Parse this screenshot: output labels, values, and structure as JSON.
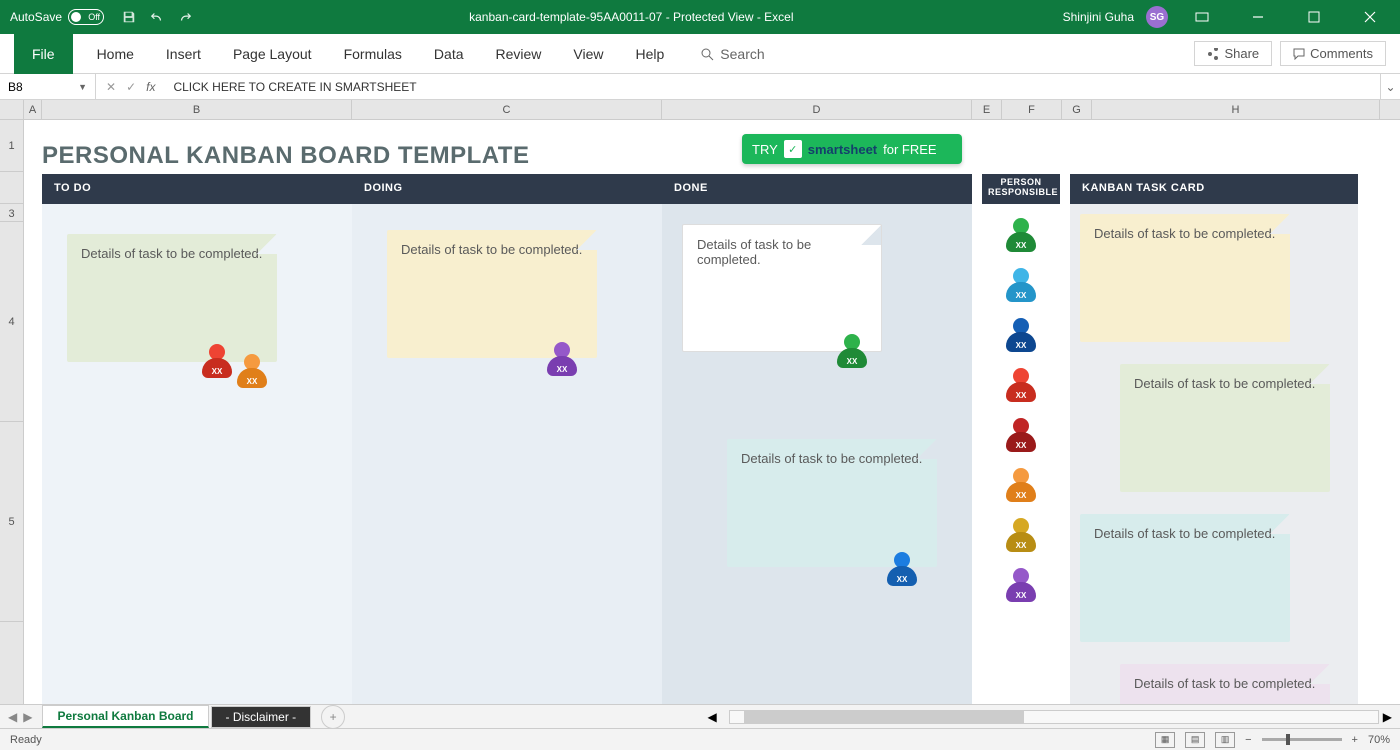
{
  "titlebar": {
    "autosave_label": "AutoSave",
    "autosave_state": "Off",
    "doc_title": "kanban-card-template-95AA0011-07  -  Protected View  -  Excel",
    "user_name": "Shinjini Guha",
    "user_initials": "SG"
  },
  "ribbon": {
    "tabs": [
      "File",
      "Home",
      "Insert",
      "Page Layout",
      "Formulas",
      "Data",
      "Review",
      "View",
      "Help"
    ],
    "search": "Search",
    "share": "Share",
    "comments": "Comments"
  },
  "formula_bar": {
    "name_box": "B8",
    "formula": "CLICK HERE TO CREATE IN SMARTSHEET"
  },
  "columns": [
    "A",
    "B",
    "C",
    "D",
    "E",
    "F",
    "G",
    "H"
  ],
  "rows": [
    "1",
    "",
    "3",
    "4",
    "5"
  ],
  "sheet": {
    "title": "PERSONAL KANBAN BOARD TEMPLATE",
    "try_badge": {
      "try": "TRY",
      "brand": "smartsheet",
      "tail": "for FREE"
    },
    "headers": {
      "todo": "TO DO",
      "doing": "DOING",
      "done": "DONE",
      "person": "PERSON RESPONSIBLE",
      "task": "KANBAN TASK CARD"
    },
    "card_text": "Details of task to be completed.",
    "xx": "XX"
  },
  "tabs": {
    "active": "Personal Kanban Board",
    "second": "- Disclaimer -"
  },
  "status": {
    "ready": "Ready",
    "zoom": "70%"
  }
}
